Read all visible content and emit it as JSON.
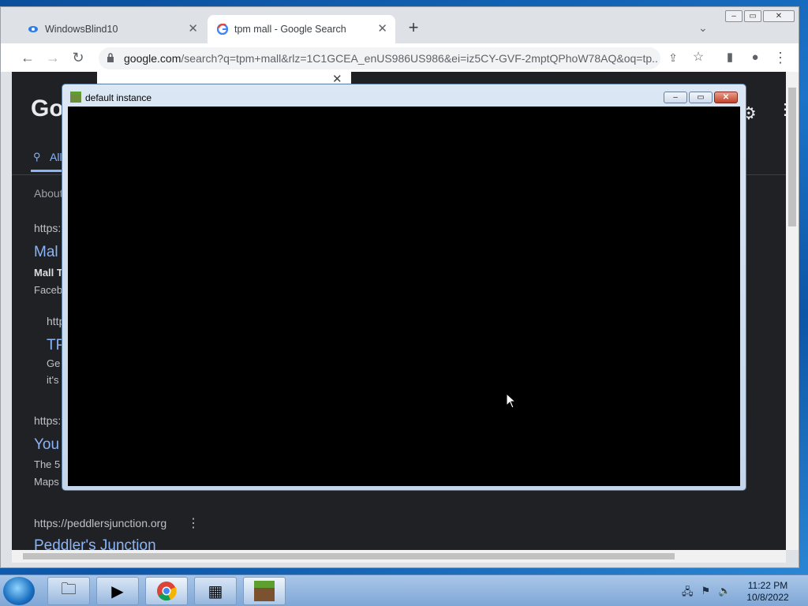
{
  "browser": {
    "tabs": [
      {
        "label": "WindowsBlind10",
        "icon": "windowblinds-icon"
      },
      {
        "label": "tpm mall - Google Search",
        "icon": "google-icon"
      }
    ],
    "url_host": "google.com",
    "url_path": "/search?q=tpm+mall&rlz=1C1GCEA_enUS986US986&ei=iz5CY-GVF-2mptQPhoW78AQ&oq=tp..."
  },
  "google": {
    "logo": "Go",
    "tab_all": "All",
    "about": "About",
    "results": [
      {
        "url": "https:",
        "title": "Mal",
        "snippet1": "Mall T",
        "snippet2": "Faceb"
      },
      {
        "url": "http",
        "title": "TP",
        "snippet1": "Ge",
        "snippet2": "it's"
      },
      {
        "url": "https:",
        "title": "You",
        "snippet1": "The 5",
        "snippet2": "Maps"
      },
      {
        "url": "https://peddlersjunction.org",
        "title": "Peddler's Junction"
      }
    ]
  },
  "instance_window": {
    "title": "default instance"
  },
  "taskbar": {
    "time": "11:22 PM",
    "date": "10/8/2022"
  }
}
